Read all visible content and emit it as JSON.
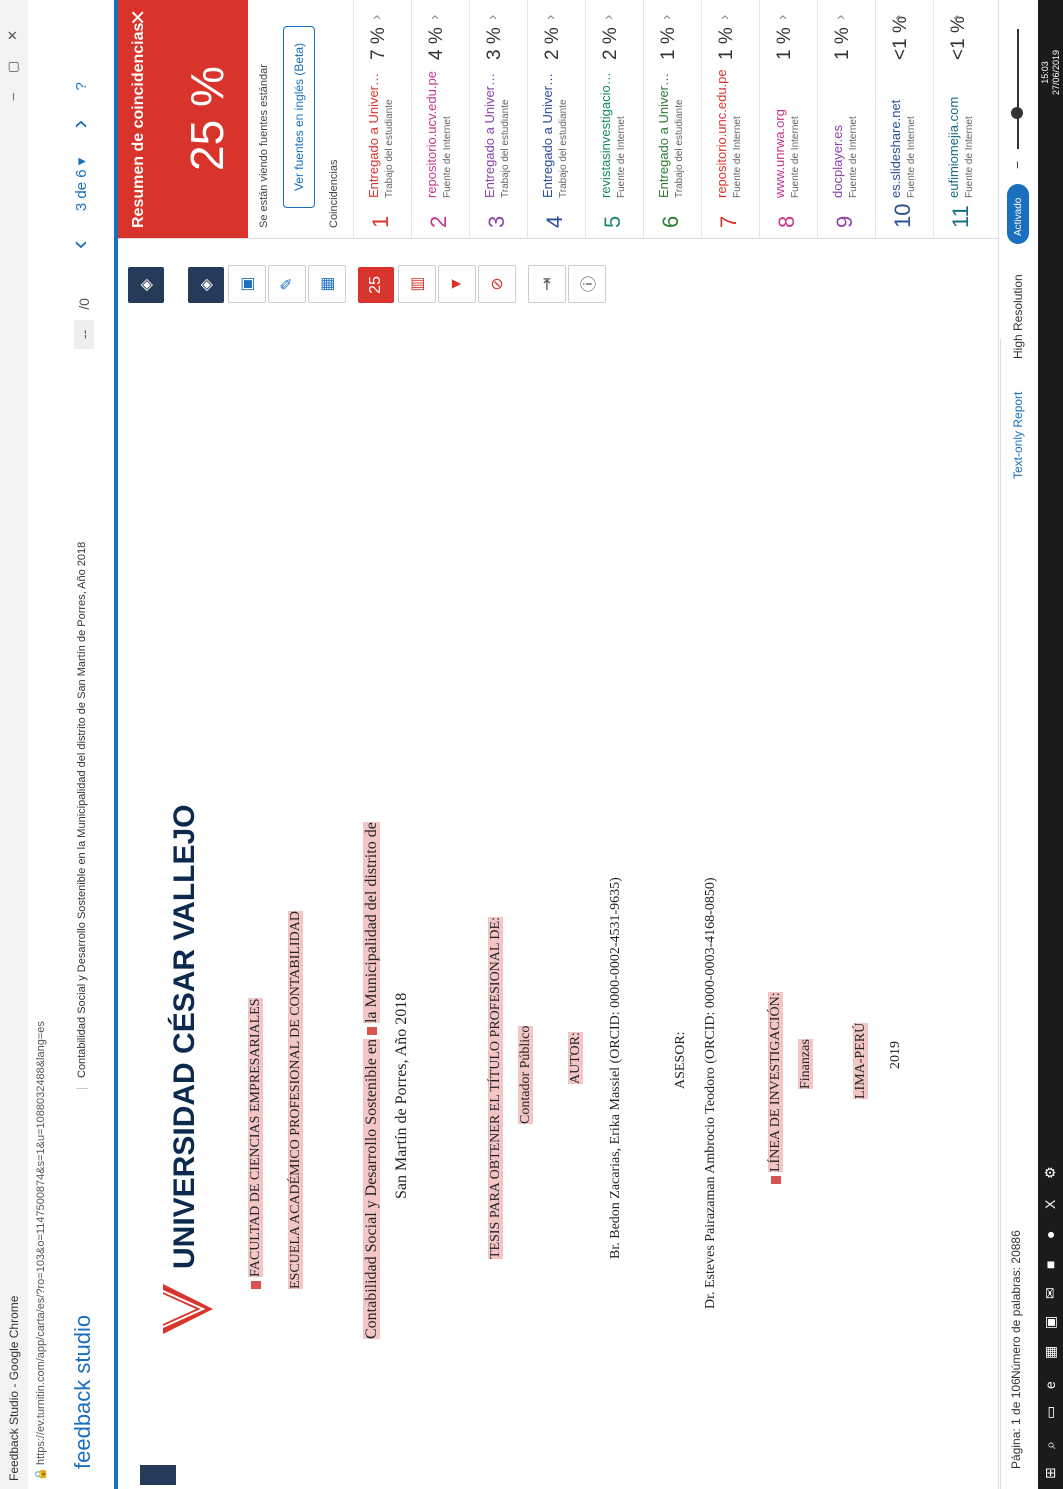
{
  "browser": {
    "title": "Feedback Studio - Google Chrome",
    "url": "https://ev.turnitin.com/app/carta/es/?ro=103&o=1147500874&s=1&u=1088032488&lang=es"
  },
  "header": {
    "logo": "feedback studio",
    "doc_title": "Contabilidad Social y Desarrollo Sostenible en la Municipalidad del distrito de San Martín de Porres, Año 2018",
    "page_counter": "/0",
    "page_box": "--",
    "nav_counter": "3 de 6 ▾",
    "help_icon": "?"
  },
  "document": {
    "university": "UNIVERSIDAD CÉSAR VALLEJO",
    "faculty": "FACULTAD DE CIENCIAS EMPRESARIALES",
    "school": "ESCUELA ACADÉMICO PROFESIONAL DE CONTABILIDAD",
    "title_line1_a": "Contabilidad Social y Desarrollo Sostenible en",
    "title_line1_b": "la Municipalidad del distrito de",
    "title_line2": "San Martín de Porres, Año 2018",
    "thesis": "TESIS PARA OBTENER EL TÍTULO PROFESIONAL DE:",
    "degree": "Contador Público",
    "author_label": "AUTOR:",
    "author": "Br. Bedon Zacarias, Erika Massiel (ORCID: 0000-0002-4531-9635)",
    "advisor_label": "ASESOR:",
    "advisor": "Dr. Esteves Pairazaman Ambrocio Teodoro (ORCID: 0000-0003-4168-0850)",
    "line_label": "LÍNEA DE INVESTIGACIÓN:",
    "line_value": "Finanzas",
    "place": "LIMA-PERÚ",
    "year": "2019"
  },
  "footer": {
    "page": "Página: 1 de 106",
    "words": "Número de palabras: 20886"
  },
  "toolbar": {
    "match_count": "25"
  },
  "panel": {
    "title": "Resumen de coincidencias",
    "percent": "25 %",
    "info": "Se están viendo fuentes estándar",
    "english_btn": "Ver fuentes en inglés (Beta)",
    "matches_label": "Coincidencias",
    "matches": [
      {
        "num": "1",
        "source": "Entregado a Universida...",
        "type": "Trabajo del estudiante",
        "pct": "7 %",
        "color": "#d9342b"
      },
      {
        "num": "2",
        "source": "repositorio.ucv.edu.pe",
        "type": "Fuente de Internet",
        "pct": "4 %",
        "color": "#c8378f"
      },
      {
        "num": "3",
        "source": "Entregado a Universida...",
        "type": "Trabajo del estudiante",
        "pct": "3 %",
        "color": "#8e44ad"
      },
      {
        "num": "4",
        "source": "Entregado a Universida...",
        "type": "Trabajo del estudiante",
        "pct": "2 %",
        "color": "#2a4f9c"
      },
      {
        "num": "5",
        "source": "revistasinvestigacion.u...",
        "type": "Fuente de Internet",
        "pct": "2 %",
        "color": "#1a8a6a"
      },
      {
        "num": "6",
        "source": "Entregado a Universida...",
        "type": "Trabajo del estudiante",
        "pct": "1 %",
        "color": "#2e7d32"
      },
      {
        "num": "7",
        "source": "repositorio.unc.edu.pe",
        "type": "Fuente de Internet",
        "pct": "1 %",
        "color": "#d9342b"
      },
      {
        "num": "8",
        "source": "www.unrwa.org",
        "type": "Fuente de Internet",
        "pct": "1 %",
        "color": "#c8378f"
      },
      {
        "num": "9",
        "source": "docplayer.es",
        "type": "Fuente de Internet",
        "pct": "1 %",
        "color": "#8e44ad"
      },
      {
        "num": "10",
        "source": "es.slideshare.net",
        "type": "Fuente de Internet",
        "pct": "<1 %",
        "color": "#2a4f9c"
      },
      {
        "num": "11",
        "source": "eufimiomejia.com",
        "type": "Fuente de Internet",
        "pct": "<1 %",
        "color": "#1a6a8a"
      }
    ]
  },
  "status": {
    "text_only": "Text-only Report",
    "high_res": "High Resolution",
    "toggle": "Activado"
  },
  "taskbar": {
    "time": "15:03",
    "date": "27/06/2019"
  },
  "colors": {
    "accent": "#1a6fbf",
    "match_red": "#d9342b",
    "dark": "#263a5a"
  }
}
